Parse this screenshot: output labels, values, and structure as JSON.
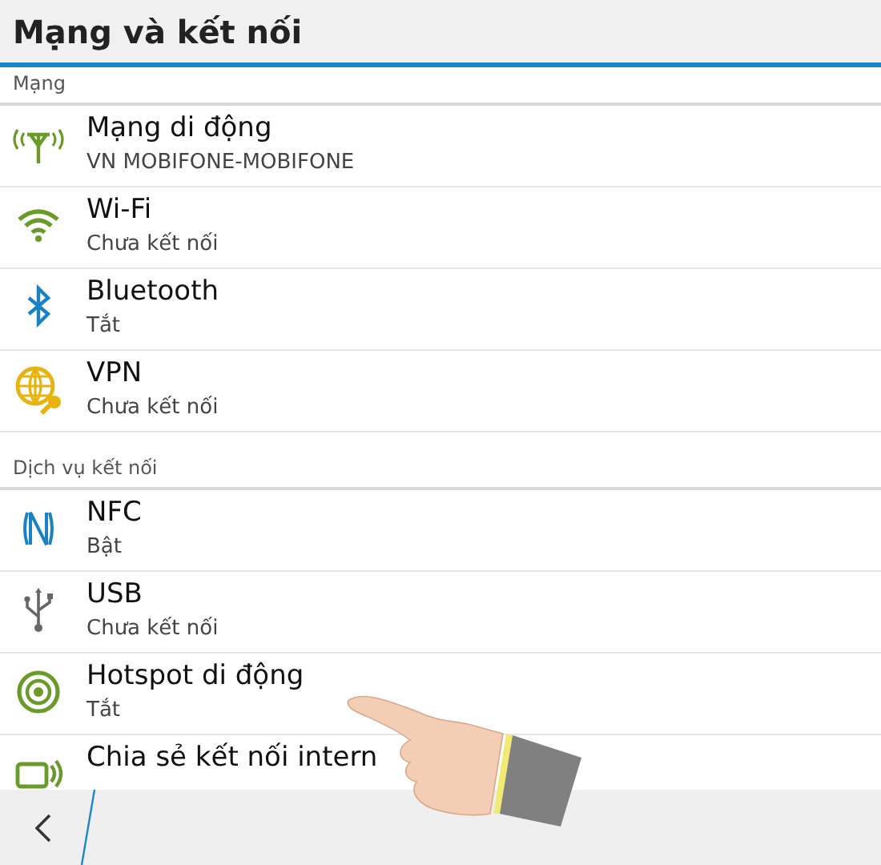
{
  "header": {
    "title": "Mạng và kết nối"
  },
  "sections": [
    {
      "label": "Mạng",
      "items": [
        {
          "title": "Mạng di động",
          "subtitle": "VN MOBIFONE-MOBIFONE"
        },
        {
          "title": "Wi-Fi",
          "subtitle": "Chưa kết nối"
        },
        {
          "title": "Bluetooth",
          "subtitle": "Tắt"
        },
        {
          "title": "VPN",
          "subtitle": "Chưa kết nối"
        }
      ]
    },
    {
      "label": "Dịch vụ kết nối",
      "items": [
        {
          "title": "NFC",
          "subtitle": "Bật"
        },
        {
          "title": "USB",
          "subtitle": "Chưa kết nối"
        },
        {
          "title": "Hotspot di động",
          "subtitle": "Tắt"
        },
        {
          "title": "Chia sẻ kết nối intern"
        }
      ]
    }
  ]
}
